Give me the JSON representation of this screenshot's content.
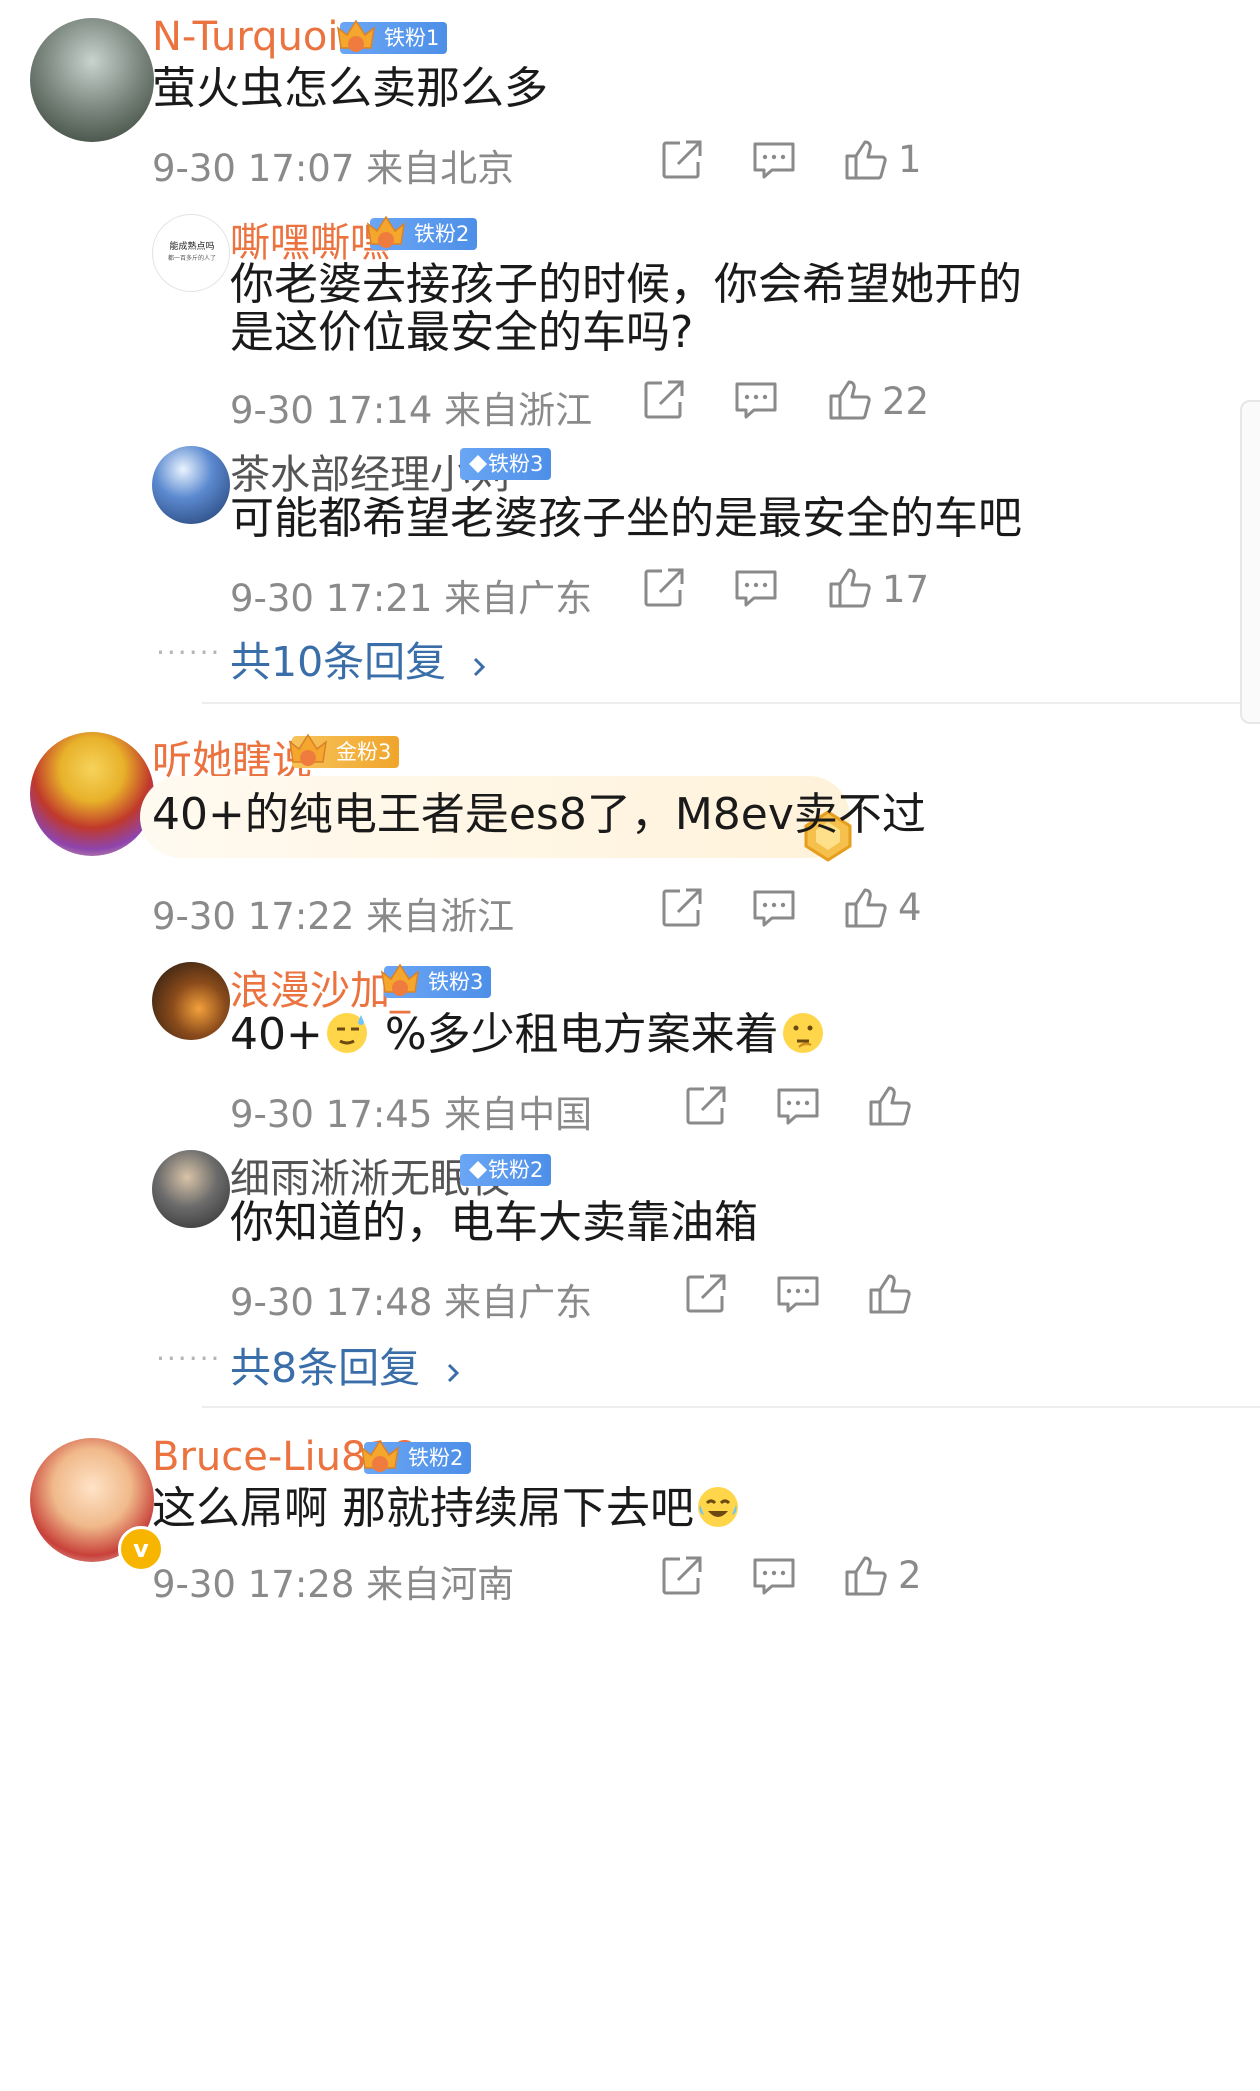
{
  "comments": [
    {
      "user": "N-Turquoise",
      "badge": "铁粉1",
      "badge_level": "2",
      "text": "萤火虫怎么卖那么多",
      "time": "9-30 17:07",
      "location": "来自北京",
      "likes": "1",
      "replies": [
        {
          "user": "嘶嘿嘶嘿",
          "badge": "铁粉2",
          "badge_level": "1",
          "avatar_text": "能成熟点吗",
          "avatar_sub": "都一百多斤的人了",
          "text_lines": [
            "你老婆去接孩子的时候，你会希望她开的",
            "是这价位最安全的车吗?"
          ],
          "time": "9-30 17:14",
          "location": "来自浙江",
          "likes": "22"
        },
        {
          "user": "茶水部经理小刘",
          "badge": "铁粉3",
          "text_lines": [
            "可能都希望老婆孩子坐的是最安全的车吧"
          ],
          "time": "9-30 17:21",
          "location": "来自广东",
          "likes": "17"
        }
      ],
      "more_replies": "共10条回复"
    },
    {
      "user": "听她瞎说",
      "badge": "金粉3",
      "badge_level": "6",
      "text": "40+的纯电王者是es8了，M8ev卖不过",
      "time": "9-30 17:22",
      "location": "来自浙江",
      "likes": "4",
      "replies": [
        {
          "user": "浪漫沙加_",
          "badge": "铁粉3",
          "badge_level": "6",
          "text_parts": [
            "40+",
            "%多少租电方案来着"
          ],
          "time": "9-30 17:45",
          "location": "来自中国",
          "likes": ""
        },
        {
          "user": "细雨淅淅无眠夜",
          "badge": "铁粉2",
          "text_lines": [
            "你知道的，电车大卖靠油箱"
          ],
          "time": "9-30 17:48",
          "location": "来自广东",
          "likes": ""
        }
      ],
      "more_replies": "共8条回复"
    },
    {
      "user": "Bruce-Liu818",
      "badge": "铁粉2",
      "badge_level": "7",
      "text": "这么屌啊 那就持续屌下去吧",
      "time": "9-30 17:28",
      "location": "来自河南",
      "likes": "2"
    }
  ],
  "dots": "······",
  "colors": {
    "name_orange": "#eb7340",
    "link_blue": "#3a6ea8",
    "meta_grey": "#8a8a8a"
  }
}
